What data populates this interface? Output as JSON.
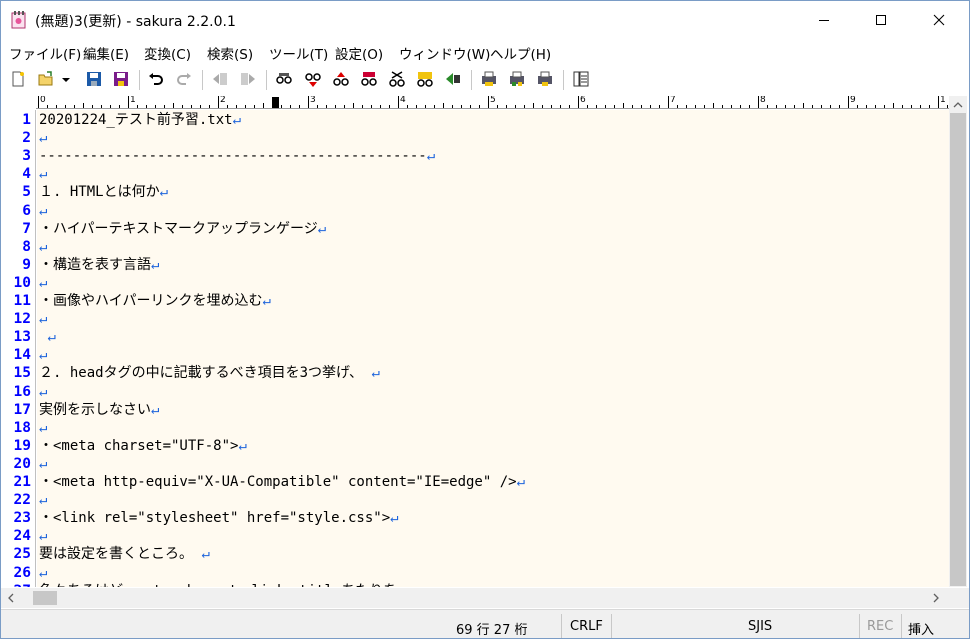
{
  "window": {
    "title": "(無題)3(更新) - sakura 2.2.0.1",
    "minimize_label": "minimize",
    "maximize_label": "maximize",
    "close_label": "close"
  },
  "menu": [
    "ファイル(F)",
    "編集(E)",
    "変換(C)",
    "検索(S)",
    "ツール(T)",
    "設定(O)",
    "ウィンドウ(W)",
    "ヘルプ(H)"
  ],
  "toolbar_icons": [
    "new-file-icon",
    "open-folder-icon",
    "dropdown-arrow-icon",
    "save-icon",
    "save-all-icon",
    "undo-icon",
    "redo-icon",
    "jump-back-icon",
    "jump-forward-icon",
    "search-icon",
    "search-prev-icon",
    "search-next-icon",
    "replace-icon",
    "clear-highlight-icon",
    "grep-icon",
    "jump-tag-icon",
    "print-icon",
    "print-preview-icon",
    "page-setup-icon",
    "outline-icon"
  ],
  "ruler": [
    "0",
    "1",
    "2",
    "3",
    "4",
    "5",
    "6",
    "7",
    "8",
    "9",
    "1"
  ],
  "lines": [
    {
      "n": "1",
      "t": "20201224_テスト前予習.txt"
    },
    {
      "n": "2",
      "t": ""
    },
    {
      "n": "3",
      "t": "----------------------------------------------"
    },
    {
      "n": "4",
      "t": ""
    },
    {
      "n": "5",
      "t": "１. HTMLとは何か"
    },
    {
      "n": "6",
      "t": ""
    },
    {
      "n": "7",
      "t": "・ハイパーテキストマークアップランゲージ"
    },
    {
      "n": "8",
      "t": ""
    },
    {
      "n": "9",
      "t": "・構造を表す言語"
    },
    {
      "n": "10",
      "t": ""
    },
    {
      "n": "11",
      "t": "・画像やハイパーリンクを埋め込む"
    },
    {
      "n": "12",
      "t": ""
    },
    {
      "n": "13",
      "t": " "
    },
    {
      "n": "14",
      "t": ""
    },
    {
      "n": "15",
      "t": "２. headタグの中に記載するべき項目を3つ挙げ、 "
    },
    {
      "n": "16",
      "t": ""
    },
    {
      "n": "17",
      "t": "実例を示しなさい"
    },
    {
      "n": "18",
      "t": ""
    },
    {
      "n": "19",
      "t": "・<meta charset=\"UTF-8\">"
    },
    {
      "n": "20",
      "t": ""
    },
    {
      "n": "21",
      "t": "・<meta http-equiv=\"X-UA-Compatible\" content=\"IE=edge\" />"
    },
    {
      "n": "22",
      "t": ""
    },
    {
      "n": "23",
      "t": "・<link rel=\"stylesheet\" href=\"style.css\">"
    },
    {
      "n": "24",
      "t": ""
    },
    {
      "n": "25",
      "t": "要は設定を書くところ。 "
    },
    {
      "n": "26",
      "t": ""
    },
    {
      "n": "27",
      "t": "色々あるけど、meta charset、link、titleあたりを"
    }
  ],
  "eol_mark": "↵",
  "status": {
    "position": "69 行  27 桁",
    "line_ending": "CRLF",
    "encoding": "SJIS",
    "rec": "REC",
    "mode": "挿入"
  }
}
